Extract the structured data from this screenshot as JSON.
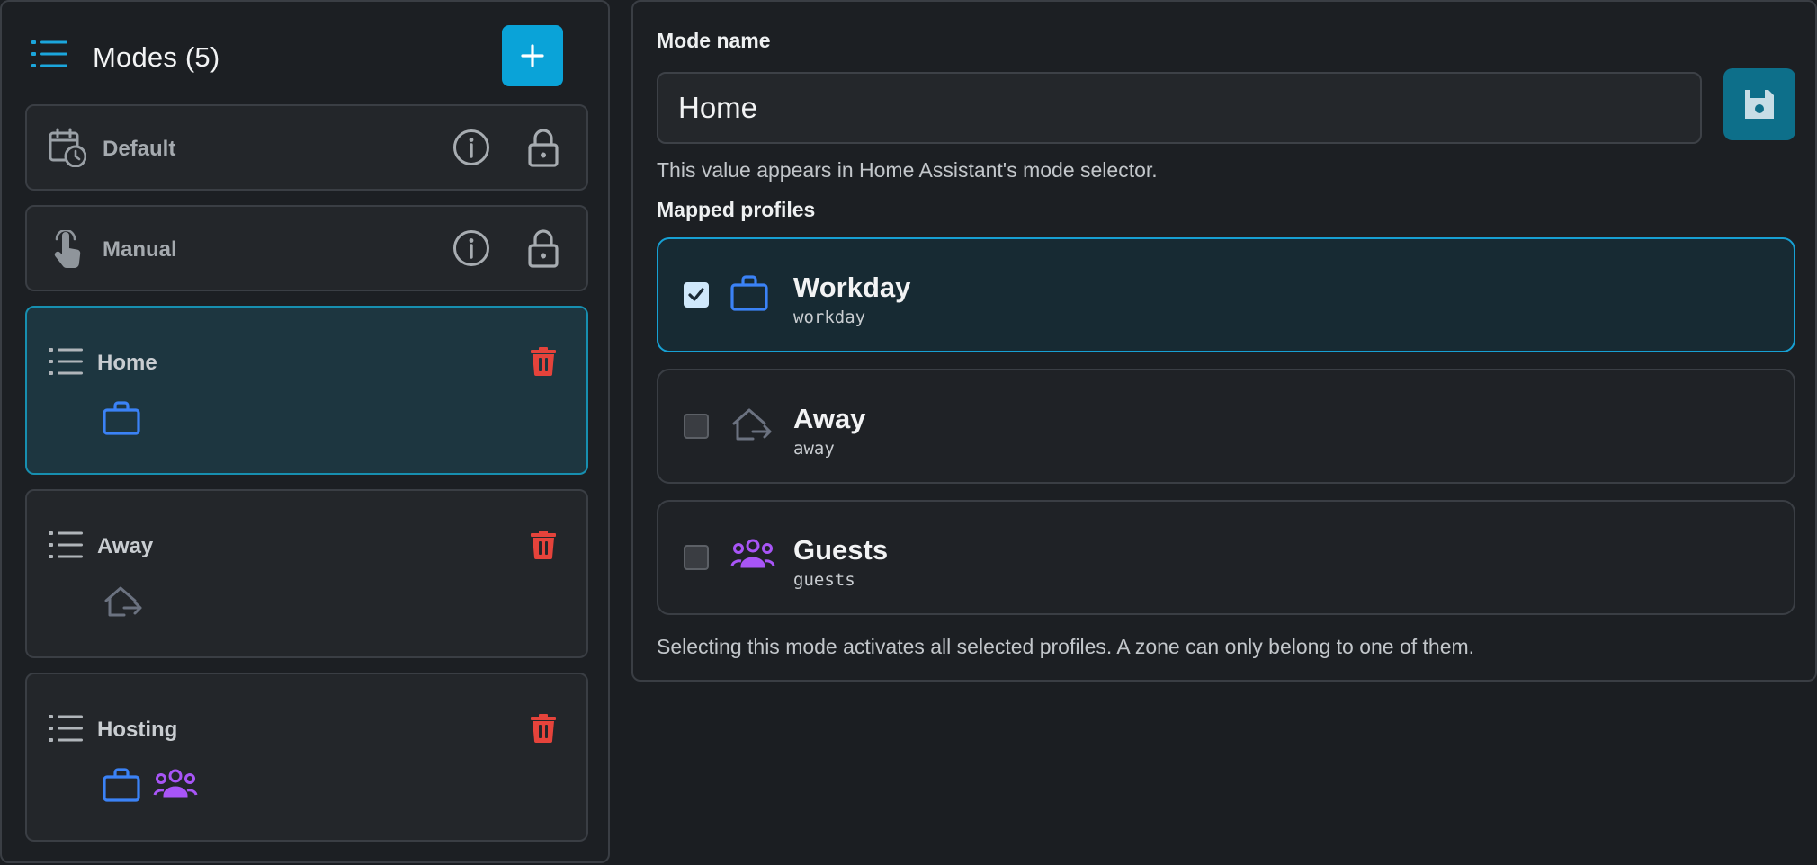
{
  "sidebar": {
    "title": "Modes (5)",
    "modes": [
      {
        "label": "Default",
        "locked": true
      },
      {
        "label": "Manual",
        "locked": true
      },
      {
        "label": "Home",
        "selected": true,
        "profiles": [
          "briefcase-icon"
        ]
      },
      {
        "label": "Away",
        "profiles": [
          "home-export-icon"
        ]
      },
      {
        "label": "Hosting",
        "profiles": [
          "briefcase-icon",
          "account-group-icon"
        ]
      }
    ]
  },
  "editor": {
    "mode_name_label": "Mode name",
    "mode_name_value": "Home",
    "mode_name_help": "This value appears in Home Assistant's mode selector.",
    "mapped_profiles_label": "Mapped profiles",
    "profiles": [
      {
        "name": "Workday",
        "id": "workday",
        "checked": true,
        "icon": "briefcase-icon"
      },
      {
        "name": "Away",
        "id": "away",
        "checked": false,
        "icon": "home-export-icon"
      },
      {
        "name": "Guests",
        "id": "guests",
        "checked": false,
        "icon": "account-group-icon"
      }
    ],
    "footer_help": "Selecting this mode activates all selected profiles. A zone can only belong to one of them."
  },
  "colors": {
    "accent": "#0aa3d8",
    "selected_border": "#17a0d3",
    "delete": "#e5433b",
    "briefcase": "#3b82f6",
    "group": "#a855f7",
    "muted_icon": "#6b7280"
  }
}
